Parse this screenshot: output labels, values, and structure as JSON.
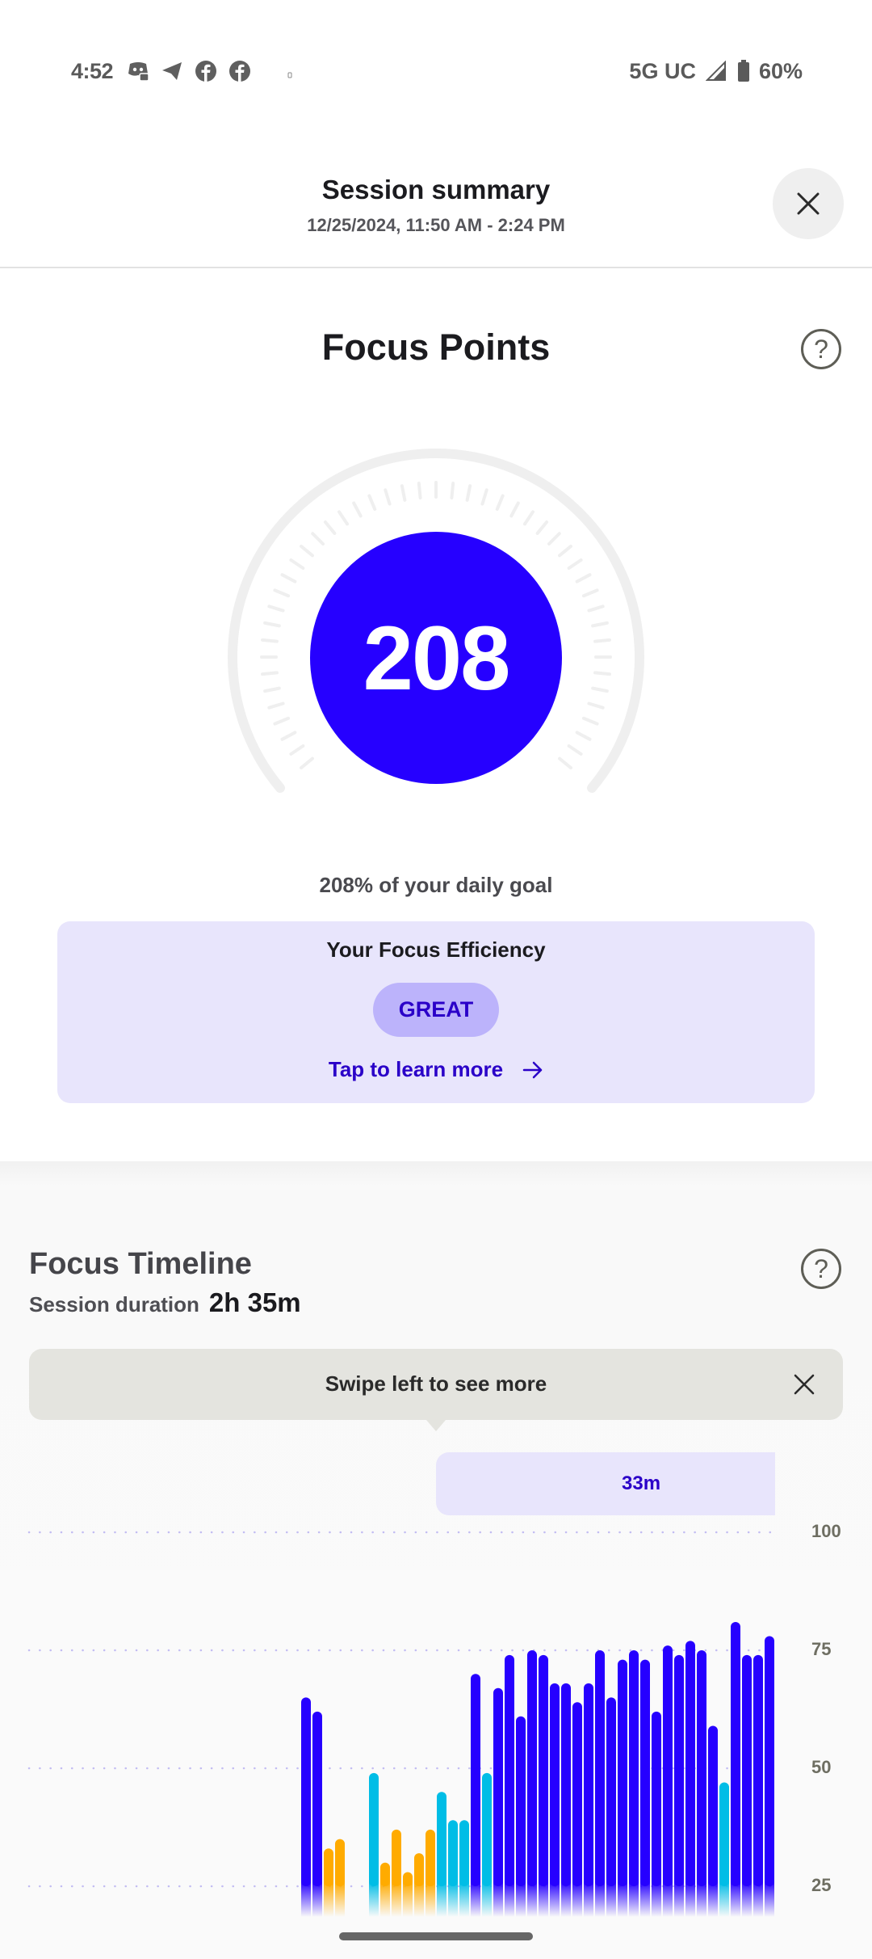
{
  "status_bar": {
    "time": "4:52",
    "notification_icons": [
      "discord-icon",
      "telegram-icon",
      "facebook-icon",
      "facebook-icon",
      "small-dot-icon"
    ],
    "network": "5G UC",
    "signal_icon": "signal-icon",
    "battery_icon": "battery-icon",
    "battery": "60%"
  },
  "header": {
    "title": "Session summary",
    "subtitle": "12/25/2024, 11:50 AM - 2:24 PM",
    "close_icon": "close-icon"
  },
  "focus_points": {
    "title": "Focus Points",
    "help_icon": "help-icon",
    "score": "208",
    "goal_percent": 208,
    "goal_text": "208% of your daily goal"
  },
  "efficiency": {
    "title": "Your Focus Efficiency",
    "badge": "GREAT",
    "link_label": "Tap to learn more",
    "link_icon": "arrow-right-icon"
  },
  "timeline": {
    "title": "Focus Timeline",
    "help_icon": "help-icon",
    "duration_label": "Session duration",
    "duration_value": "2h 35m",
    "tip_text": "Swipe left to see more",
    "tip_close_icon": "close-icon",
    "range_label": "33m"
  },
  "colors": {
    "accent": "#2600ff",
    "cyan": "#00bde6",
    "orange": "#ffab00",
    "card_bg": "#e8e5fc",
    "badge_bg": "#bcb3fb",
    "link": "#2a00c8"
  },
  "chart_data": {
    "type": "bar",
    "title": "Focus Timeline",
    "ylim": [
      0,
      100
    ],
    "yticks": [
      "100",
      "75",
      "50",
      "25"
    ],
    "ytick_values": [
      100,
      75,
      50,
      25
    ],
    "grid": true,
    "series_colors": {
      "high": "#2600ff",
      "medium": "#00bde6",
      "low": "#ffab00"
    },
    "bars": [
      {
        "value": 65,
        "level": "high"
      },
      {
        "value": 62,
        "level": "high"
      },
      {
        "value": 33,
        "level": "low"
      },
      {
        "value": 35,
        "level": "low"
      },
      {
        "value": null,
        "level": "none"
      },
      {
        "value": null,
        "level": "none"
      },
      {
        "value": 49,
        "level": "medium"
      },
      {
        "value": 30,
        "level": "low"
      },
      {
        "value": 37,
        "level": "low"
      },
      {
        "value": 28,
        "level": "low"
      },
      {
        "value": 32,
        "level": "low"
      },
      {
        "value": 37,
        "level": "low"
      },
      {
        "value": 45,
        "level": "medium"
      },
      {
        "value": 39,
        "level": "medium"
      },
      {
        "value": 39,
        "level": "medium"
      },
      {
        "value": 70,
        "level": "high"
      },
      {
        "value": 49,
        "level": "medium"
      },
      {
        "value": 67,
        "level": "high"
      },
      {
        "value": 74,
        "level": "high"
      },
      {
        "value": 61,
        "level": "high"
      },
      {
        "value": 75,
        "level": "high"
      },
      {
        "value": 74,
        "level": "high"
      },
      {
        "value": 68,
        "level": "high"
      },
      {
        "value": 68,
        "level": "high"
      },
      {
        "value": 64,
        "level": "high"
      },
      {
        "value": 68,
        "level": "high"
      },
      {
        "value": 75,
        "level": "high"
      },
      {
        "value": 65,
        "level": "high"
      },
      {
        "value": 73,
        "level": "high"
      },
      {
        "value": 75,
        "level": "high"
      },
      {
        "value": 73,
        "level": "high"
      },
      {
        "value": 62,
        "level": "high"
      },
      {
        "value": 76,
        "level": "high"
      },
      {
        "value": 74,
        "level": "high"
      },
      {
        "value": 77,
        "level": "high"
      },
      {
        "value": 75,
        "level": "high"
      },
      {
        "value": 59,
        "level": "high"
      },
      {
        "value": 47,
        "level": "medium"
      },
      {
        "value": 81,
        "level": "high"
      },
      {
        "value": 74,
        "level": "high"
      },
      {
        "value": 74,
        "level": "high"
      },
      {
        "value": 78,
        "level": "high"
      },
      {
        "value": 58,
        "level": "medium"
      }
    ]
  }
}
